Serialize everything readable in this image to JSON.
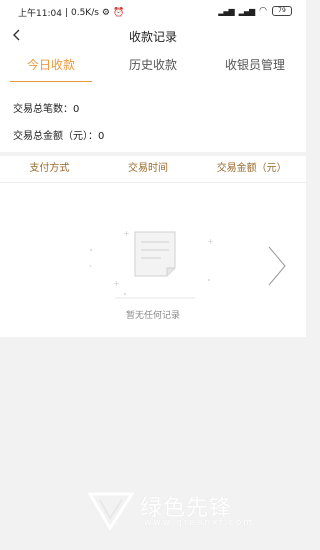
{
  "status_bar": {
    "time_text": "上午11:04",
    "speed_text": "0.5K/s",
    "signal1": "ᵢₗₗ",
    "signal2": "ₗₗ",
    "battery_text": "79"
  },
  "header": {
    "title": "收款记录"
  },
  "tabs": [
    {
      "label": "今日收款",
      "active": true
    },
    {
      "label": "历史收款",
      "active": false
    },
    {
      "label": "收银员管理",
      "active": false
    }
  ],
  "summary": {
    "count_label": "交易总笔数：",
    "count_value": "0",
    "amount_label": "交易总金额（元）：",
    "amount_value": "0"
  },
  "table": {
    "columns": [
      "支付方式",
      "交易时间",
      "交易金额（元）"
    ]
  },
  "empty_state": {
    "message": "暂无任何记录"
  },
  "watermark": {
    "text": "绿色先锋",
    "url": "www.greenxf.com"
  },
  "colors": {
    "accent": "#e69a3c",
    "header_text": "#9a6a2c",
    "background": "#f2f2f2"
  }
}
